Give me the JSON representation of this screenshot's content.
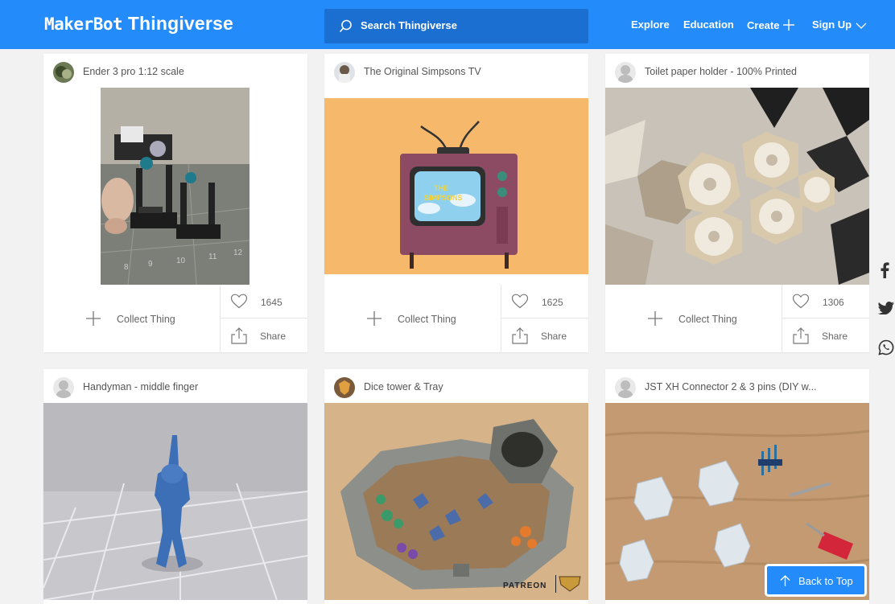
{
  "header": {
    "logo_maker": "MakerBot",
    "logo_thingi": "Thingiverse",
    "search_placeholder": "Search Thingiverse",
    "nav": {
      "explore": "Explore",
      "education": "Education",
      "create": "Create",
      "signup": "Sign Up"
    }
  },
  "cards": [
    {
      "title": "Ender 3 pro 1:12 scale",
      "likes": "1645",
      "collect": "Collect Thing",
      "share": "Share"
    },
    {
      "title": "The Original Simpsons TV",
      "likes": "1625",
      "collect": "Collect Thing",
      "share": "Share"
    },
    {
      "title": "Toilet paper holder - 100% Printed",
      "likes": "1306",
      "collect": "Collect Thing",
      "share": "Share"
    },
    {
      "title": "Handyman - middle finger"
    },
    {
      "title": "Dice tower & Tray",
      "image_text": "PATREON"
    },
    {
      "title": "JST XH Connector 2 & 3 pins (DIY w..."
    }
  ],
  "social": [
    "facebook-icon",
    "twitter-icon",
    "whatsapp-icon"
  ],
  "back_to_top": "Back to Top",
  "colors": {
    "brand": "#248bfb",
    "search_bg": "#1a6fd0",
    "page_bg": "#f2f2f2"
  }
}
